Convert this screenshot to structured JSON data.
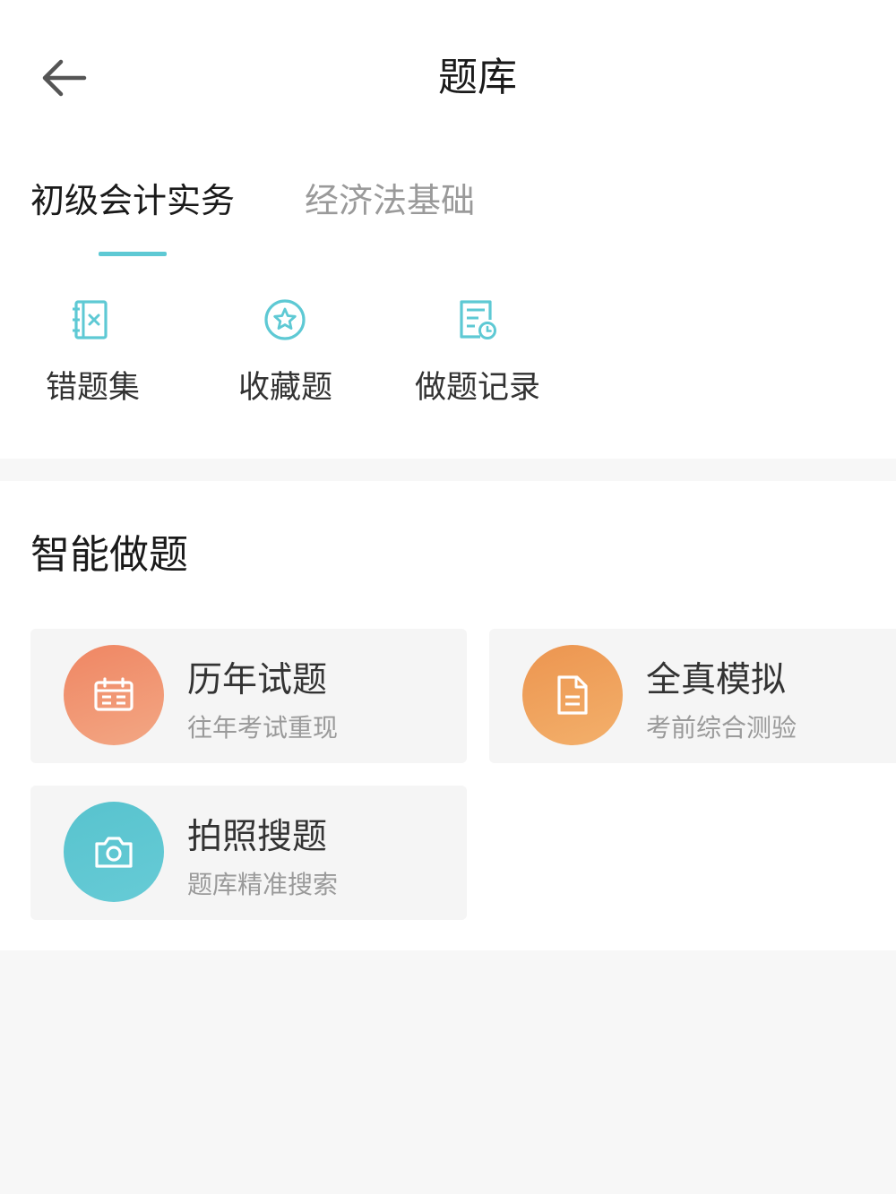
{
  "header": {
    "title": "题库"
  },
  "tabs": [
    {
      "label": "初级会计实务",
      "active": true
    },
    {
      "label": "经济法基础",
      "active": false
    }
  ],
  "shortcuts": [
    {
      "label": "错题集",
      "icon": "wrong-notebook-icon"
    },
    {
      "label": "收藏题",
      "icon": "star-circle-icon"
    },
    {
      "label": "做题记录",
      "icon": "record-clock-icon"
    }
  ],
  "smart_practice": {
    "title": "智能做题",
    "cards": [
      {
        "title": "历年试题",
        "subtitle": "往年考试重现",
        "icon": "calendar-icon",
        "color": "#f08f6c"
      },
      {
        "title": "全真模拟",
        "subtitle": "考前综合测验",
        "icon": "document-icon",
        "color": "#ef9d55"
      },
      {
        "title": "拍照搜题",
        "subtitle": "题库精准搜索",
        "icon": "camera-icon",
        "color": "#5ec6d0"
      }
    ]
  },
  "colors": {
    "accent": "#5ec9d4",
    "background": "#f7f7f7"
  }
}
